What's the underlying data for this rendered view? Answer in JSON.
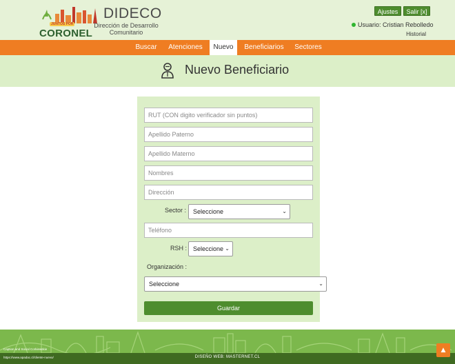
{
  "header": {
    "logo_tagline": "JUNTOS POR",
    "logo_text": "CORONEL",
    "brand_title": "DIDECO",
    "brand_subtitle": "Dirección de Desarrollo Comunitario",
    "buttons": {
      "settings": "Ajustes",
      "logout": "Salir [x]"
    },
    "user": "Usuario: Cristian Rebolledo",
    "history": "Historial",
    "status_color": "#2fb52f"
  },
  "nav": {
    "items": [
      {
        "label": "Buscar"
      },
      {
        "label": "Atenciones"
      },
      {
        "label": "Nuevo",
        "active": true
      },
      {
        "label": "Beneficiarios"
      },
      {
        "label": "Sectores"
      }
    ]
  },
  "page": {
    "title": "Nuevo Beneficiario",
    "icon": "user-icon"
  },
  "form": {
    "rut_placeholder": "RUT (CON digito verificador sin puntos)",
    "apellido_paterno_placeholder": "Apellido Paterno",
    "apellido_materno_placeholder": "Apellido Materno",
    "nombres_placeholder": "Nombres",
    "direccion_placeholder": "Dirección",
    "sector_label": "Sector :",
    "sector_selected": "Seleccione",
    "telefono_placeholder": "Teléfono",
    "rsh_label": "RSH :",
    "rsh_selected": "Seleccione",
    "organizacion_label": "Organización :",
    "organizacion_selected": "Seleccione",
    "save_label": "Guardar"
  },
  "footer": {
    "caption_line1": "Caption and Social Corkiewskie",
    "caption_line2": "https://www.apadac.cl/cliente-nuevo/",
    "credit": "DISEÑO WEB: MASTERNET.CL"
  },
  "colors": {
    "brand_green": "#4e8d2e",
    "nav_orange": "#ef7d22",
    "panel_green": "#dcefc8",
    "header_bg": "#e6f2d7"
  }
}
